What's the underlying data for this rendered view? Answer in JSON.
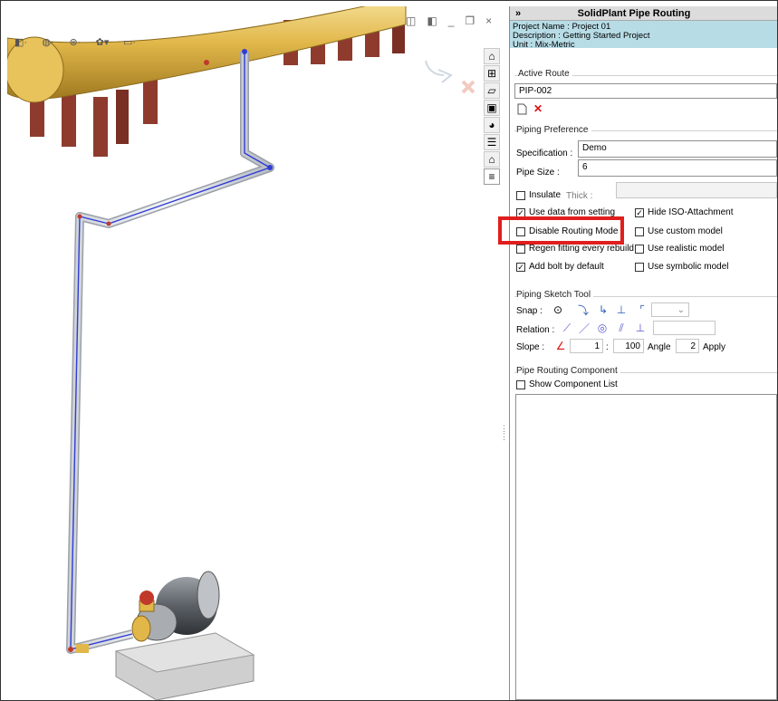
{
  "panel": {
    "collapse_symbol": "»",
    "title": "SolidPlant Pipe Routing",
    "project_name": "Project Name : Project 01",
    "description": "Description : Getting Started Project",
    "unit": "Unit : Mix-Metric",
    "active_route": {
      "label": "Active Route",
      "value": "PIP-002"
    },
    "piping_preference": {
      "label": "Piping Preference",
      "specification_label": "Specification :",
      "specification_value": "Demo",
      "pipe_size_label": "Pipe Size :",
      "pipe_size_value": "6",
      "insulate_label": "Insulate",
      "thick_label": "Thick :",
      "use_data_label": "Use data from setting",
      "hide_iso_label": "Hide ISO-Attachment",
      "disable_routing_label": "Disable Routing Mode",
      "use_custom_label": "Use custom model",
      "regen_label": "Regen fitting every rebuild",
      "use_realistic_label": "Use realistic model",
      "add_bolt_label": "Add bolt by default",
      "use_symbolic_label": "Use symbolic model",
      "checked": {
        "insulate": false,
        "use_data": true,
        "hide_iso": true,
        "disable_routing": false,
        "use_custom": false,
        "regen": false,
        "use_realistic": false,
        "add_bolt": true,
        "use_symbolic": false
      }
    },
    "sketch_tool": {
      "label": "Piping Sketch Tool",
      "snap_label": "Snap :",
      "relation_label": "Relation :",
      "slope_label": "Slope :",
      "slope_value": "1",
      "slope_sep": ":",
      "slope_run": "100",
      "angle_label": "Angle",
      "angle_value": "2",
      "apply_label": "Apply"
    },
    "component": {
      "label": "Pipe Routing Component",
      "show_list_label": "Show Component List"
    }
  },
  "viewport": {
    "window_controls": [
      "◫",
      "◧",
      "_",
      "❐",
      "×"
    ]
  },
  "icons": {
    "home": "home-icon",
    "part": "part-icon",
    "folder": "folder-icon",
    "view_palette": "view-palette-icon",
    "appearance": "appearance-icon",
    "properties": "custom-properties-icon",
    "plant": "plant-icon",
    "pipe": "pipe-routing-icon"
  },
  "colors": {
    "info_bg": "#b7dce6",
    "highlight": "#e01e1e",
    "vessel": "#e1b74a",
    "support": "#8e3b2e",
    "pipe": "#2f3cd4"
  }
}
